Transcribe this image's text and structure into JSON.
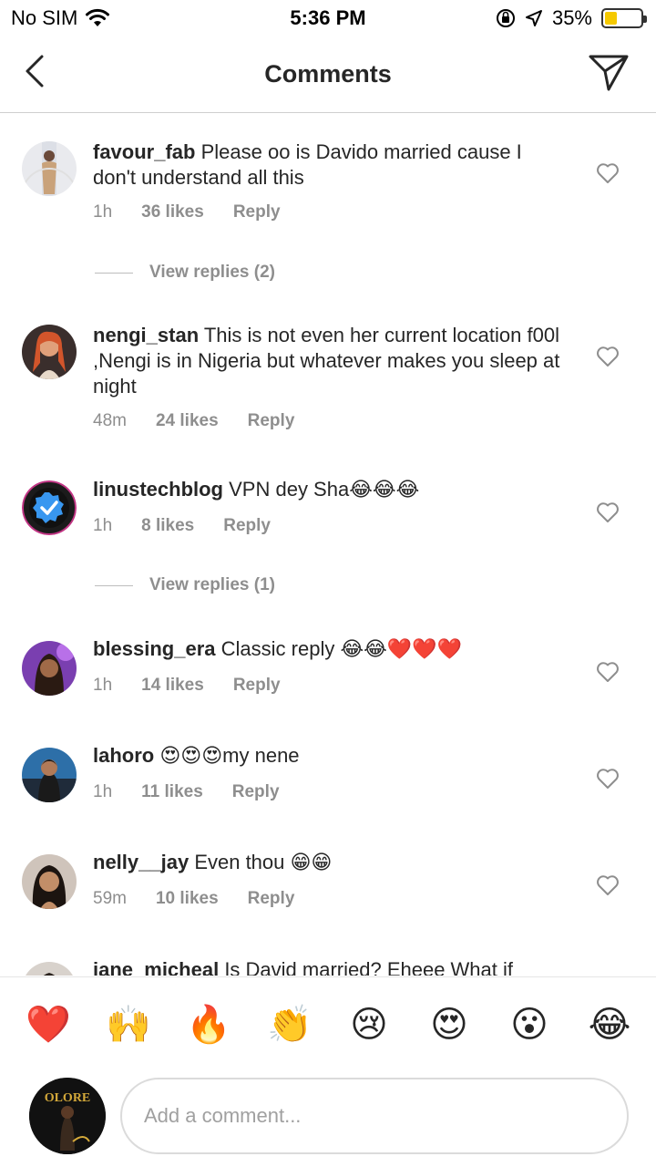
{
  "status_bar": {
    "carrier": "No SIM",
    "time": "5:36 PM",
    "battery_percent": "35%",
    "battery_level": 0.35,
    "battery_color": "#f5c900",
    "icons": [
      "wifi-icon",
      "orientation-lock-icon",
      "location-arrow-icon",
      "battery-icon"
    ]
  },
  "nav": {
    "title": "Comments",
    "back_icon": "chevron-left-icon",
    "send_icon": "paper-plane-icon"
  },
  "comments": [
    {
      "username": "favour_fab",
      "text": "Please oo is Davido married cause I don't understand all this",
      "time": "1h",
      "likes": "36 likes",
      "reply": "Reply",
      "view_replies": "View replies (2)"
    },
    {
      "username": "nengi_stan",
      "text": "This is not even her current location f00l ,Nengi is in Nigeria but whatever makes you sleep at night",
      "time": "48m",
      "likes": "24 likes",
      "reply": "Reply"
    },
    {
      "username": "linustechblog",
      "text": "VPN dey Sha😂😂😂",
      "time": "1h",
      "likes": "8 likes",
      "reply": "Reply",
      "view_replies": "View replies (1)"
    },
    {
      "username": "blessing_era",
      "text": "Classic reply 😂😂❤️❤️❤️",
      "time": "1h",
      "likes": "14 likes",
      "reply": "Reply"
    },
    {
      "username": "lahoro",
      "text": "😍😍😍my nene",
      "time": "1h",
      "likes": "11 likes",
      "reply": "Reply"
    },
    {
      "username": "nelly__jay",
      "text": "Even thou 😁😁",
      "time": "59m",
      "likes": "10 likes",
      "reply": "Reply"
    },
    {
      "username": "jane_micheal",
      "text": "Is David married? Eheee What  if"
    }
  ],
  "emoji_bar": [
    "❤️",
    "🙌",
    "🔥",
    "👏",
    "😢",
    "😍",
    "😮",
    "😂"
  ],
  "composer": {
    "placeholder": "Add a comment...",
    "avatar_text": "OLORE"
  }
}
